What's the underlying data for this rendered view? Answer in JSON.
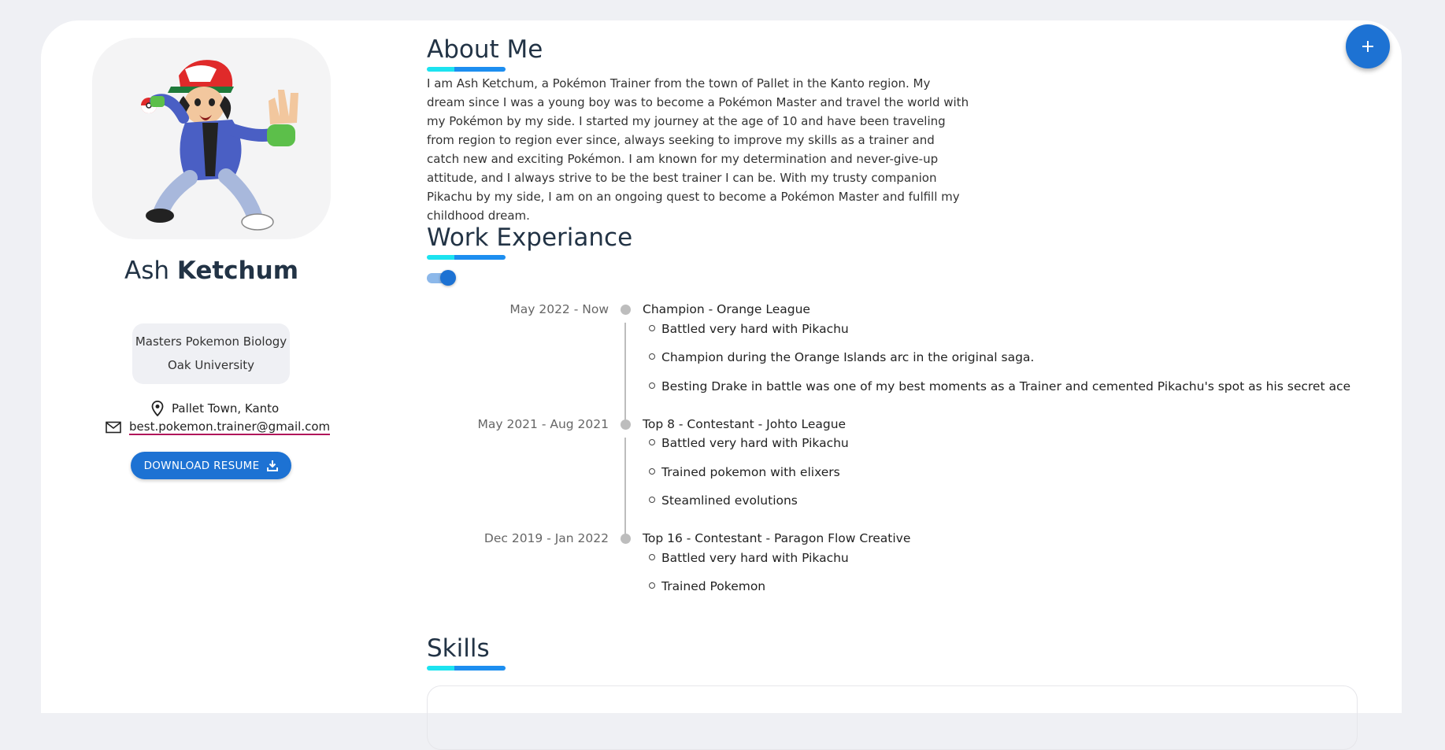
{
  "profile": {
    "first_name": "Ash",
    "last_name": "Ketchum",
    "education_degree": "Masters Pokemon Biology",
    "education_school": "Oak University",
    "location": "Pallet Town, Kanto",
    "email": "best.pokemon.trainer@gmail.com",
    "download_label": "DOWNLOAD RESUME"
  },
  "about": {
    "heading": "About Me",
    "text": "I am Ash Ketchum, a Pokémon Trainer from the town of Pallet in the Kanto region. My dream since I was a young boy was to become a Pokémon Master and travel the world with my Pokémon by my side. I started my journey at the age of 10 and have been traveling from region to region ever since, always seeking to improve my skills as a trainer and catch new and exciting Pokémon. I am known for my determination and never-give-up attitude, and I always strive to be the best trainer I can be. With my trusty companion Pikachu by my side, I am on an ongoing quest to become a Pokémon Master and fulfill my childhood dream."
  },
  "work": {
    "heading": "Work Experiance",
    "toggle_on": true,
    "entries": [
      {
        "date": "May 2022 - Now",
        "title": "Champion - Orange League",
        "items": [
          "Battled very hard with Pikachu",
          "Champion during the Orange Islands arc in the original saga.",
          "Besting Drake in battle was one of my best moments as a Trainer and cemented Pikachu's spot as his secret ace"
        ]
      },
      {
        "date": "May 2021 - Aug 2021",
        "title": "Top 8 - Contestant - Johto League",
        "items": [
          "Battled very hard with Pikachu",
          "Trained pokemon with elixers",
          "Steamlined evolutions"
        ]
      },
      {
        "date": "Dec 2019 - Jan 2022",
        "title": "Top 16 - Contestant - Paragon Flow Creative",
        "items": [
          "Battled very hard with Pikachu",
          "Trained Pokemon"
        ]
      }
    ]
  },
  "skills": {
    "heading": "Skills"
  },
  "icons": {
    "location": "location-pin-icon",
    "email": "mail-icon",
    "download": "download-icon",
    "fab": "plus-icon"
  },
  "colors": {
    "accent": "#1d72d3",
    "heading": "#223345",
    "underline_light": "#1ce3f0",
    "underline_dark": "#1d8ef0"
  }
}
